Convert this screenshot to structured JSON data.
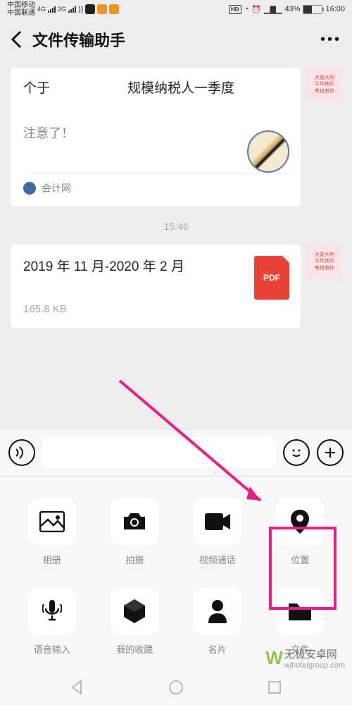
{
  "status": {
    "carrier1": "中国移动",
    "carrier2": "中国联通",
    "net1": "4G",
    "net2": "2G",
    "hd": "HD",
    "battery_pct": "43%",
    "time": "16:00"
  },
  "nav": {
    "title": "文件传输助手"
  },
  "chat": {
    "msg1": {
      "line1_a": "个于",
      "line1_b": "规模纳税人一季度",
      "line2": "注意了！",
      "source": "会计网"
    },
    "timestamp": "15:46",
    "msg2": {
      "title_a": "2019 年 11 月-2020 年 2 月",
      "size": "165.8 KB",
      "badge": "PDF"
    }
  },
  "attach": {
    "items": [
      {
        "label": "相册",
        "icon": "photo"
      },
      {
        "label": "拍摄",
        "icon": "camera"
      },
      {
        "label": "视频通话",
        "icon": "video"
      },
      {
        "label": "位置",
        "icon": "location"
      },
      {
        "label": "语音输入",
        "icon": "voice"
      },
      {
        "label": "我的收藏",
        "icon": "fav"
      },
      {
        "label": "名片",
        "icon": "contact"
      },
      {
        "label": "文件",
        "icon": "file"
      }
    ]
  },
  "watermark": {
    "name": "无极安卓网",
    "url": "wjhotelgroup.com"
  }
}
